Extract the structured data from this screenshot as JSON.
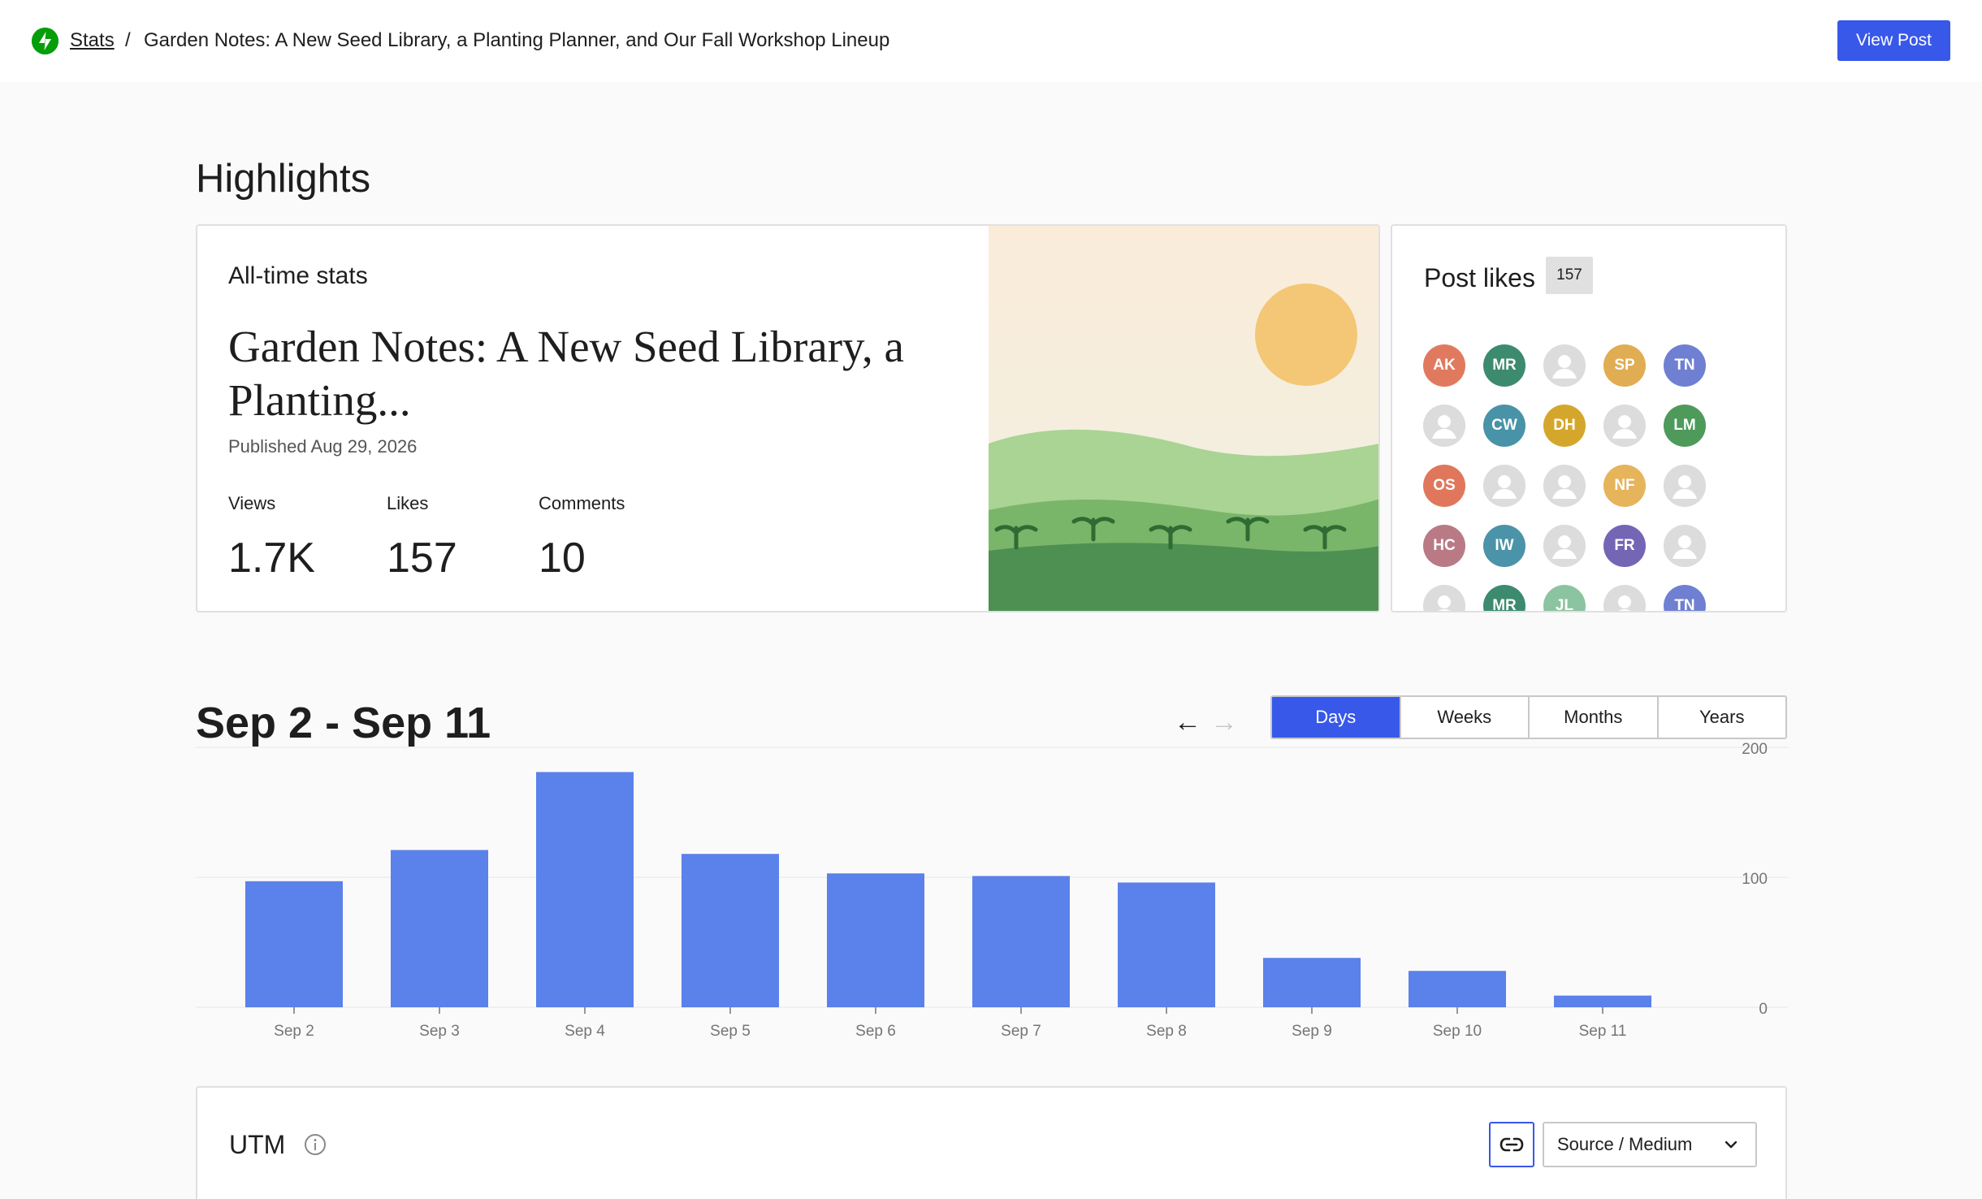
{
  "header": {
    "breadcrumb_link": "Stats",
    "separator": "/",
    "post_title": "Garden Notes: A New Seed Library, a Planting Planner, and Our Fall Workshop Lineup",
    "view_post_label": "View Post"
  },
  "highlights": {
    "section_title": "Highlights",
    "alltime_label": "All-time stats",
    "post_title_short": "Garden Notes: A New Seed Library, a Planting...",
    "published": "Published Aug 29, 2026",
    "metrics": [
      {
        "label": "Views",
        "value": "1.7K"
      },
      {
        "label": "Likes",
        "value": "157"
      },
      {
        "label": "Comments",
        "value": "10"
      }
    ]
  },
  "post_likes": {
    "title": "Post likes",
    "count": "157",
    "avatars": [
      {
        "initials": "AK",
        "color": "#e07a5f"
      },
      {
        "initials": "MR",
        "color": "#3d8b6e"
      },
      {
        "initials": "",
        "color": ""
      },
      {
        "initials": "SP",
        "color": "#e0ad52"
      },
      {
        "initials": "TN",
        "color": "#6f80d2"
      },
      {
        "initials": "",
        "color": ""
      },
      {
        "initials": "CW",
        "color": "#4893a7"
      },
      {
        "initials": "DH",
        "color": "#d4a72c"
      },
      {
        "initials": "",
        "color": ""
      },
      {
        "initials": "LM",
        "color": "#4e9a5a"
      },
      {
        "initials": "OS",
        "color": "#e0775c"
      },
      {
        "initials": "",
        "color": ""
      },
      {
        "initials": "",
        "color": ""
      },
      {
        "initials": "NF",
        "color": "#e6b45a"
      },
      {
        "initials": "",
        "color": ""
      },
      {
        "initials": "HC",
        "color": "#b97a86"
      },
      {
        "initials": "IW",
        "color": "#4b93a8"
      },
      {
        "initials": "",
        "color": ""
      },
      {
        "initials": "FR",
        "color": "#7565b5"
      },
      {
        "initials": "",
        "color": ""
      },
      {
        "initials": "",
        "color": ""
      },
      {
        "initials": "MR",
        "color": "#3d8b6e"
      },
      {
        "initials": "JL",
        "color": "#8cc3a0"
      },
      {
        "initials": "",
        "color": ""
      },
      {
        "initials": "TN",
        "color": "#6f80d2"
      }
    ]
  },
  "range": {
    "title": "Sep 2 - Sep 11",
    "prev_arrow": "←",
    "next_arrow": "→",
    "periods": [
      "Days",
      "Weeks",
      "Months",
      "Years"
    ],
    "active_period": "Days"
  },
  "chart_data": {
    "type": "bar",
    "categories": [
      "Sep 2",
      "Sep 3",
      "Sep 4",
      "Sep 5",
      "Sep 6",
      "Sep 7",
      "Sep 8",
      "Sep 9",
      "Sep 10",
      "Sep 11"
    ],
    "values": [
      97,
      121,
      181,
      118,
      103,
      101,
      96,
      38,
      28,
      9
    ],
    "yticks": [
      200,
      100,
      0
    ],
    "ylim": [
      0,
      200
    ],
    "bar_color": "#5b81ea"
  },
  "utm": {
    "title": "UTM",
    "select_label": "Source / Medium"
  },
  "colors": {
    "accent": "#3858e9",
    "jetpack_green": "#069e08"
  }
}
